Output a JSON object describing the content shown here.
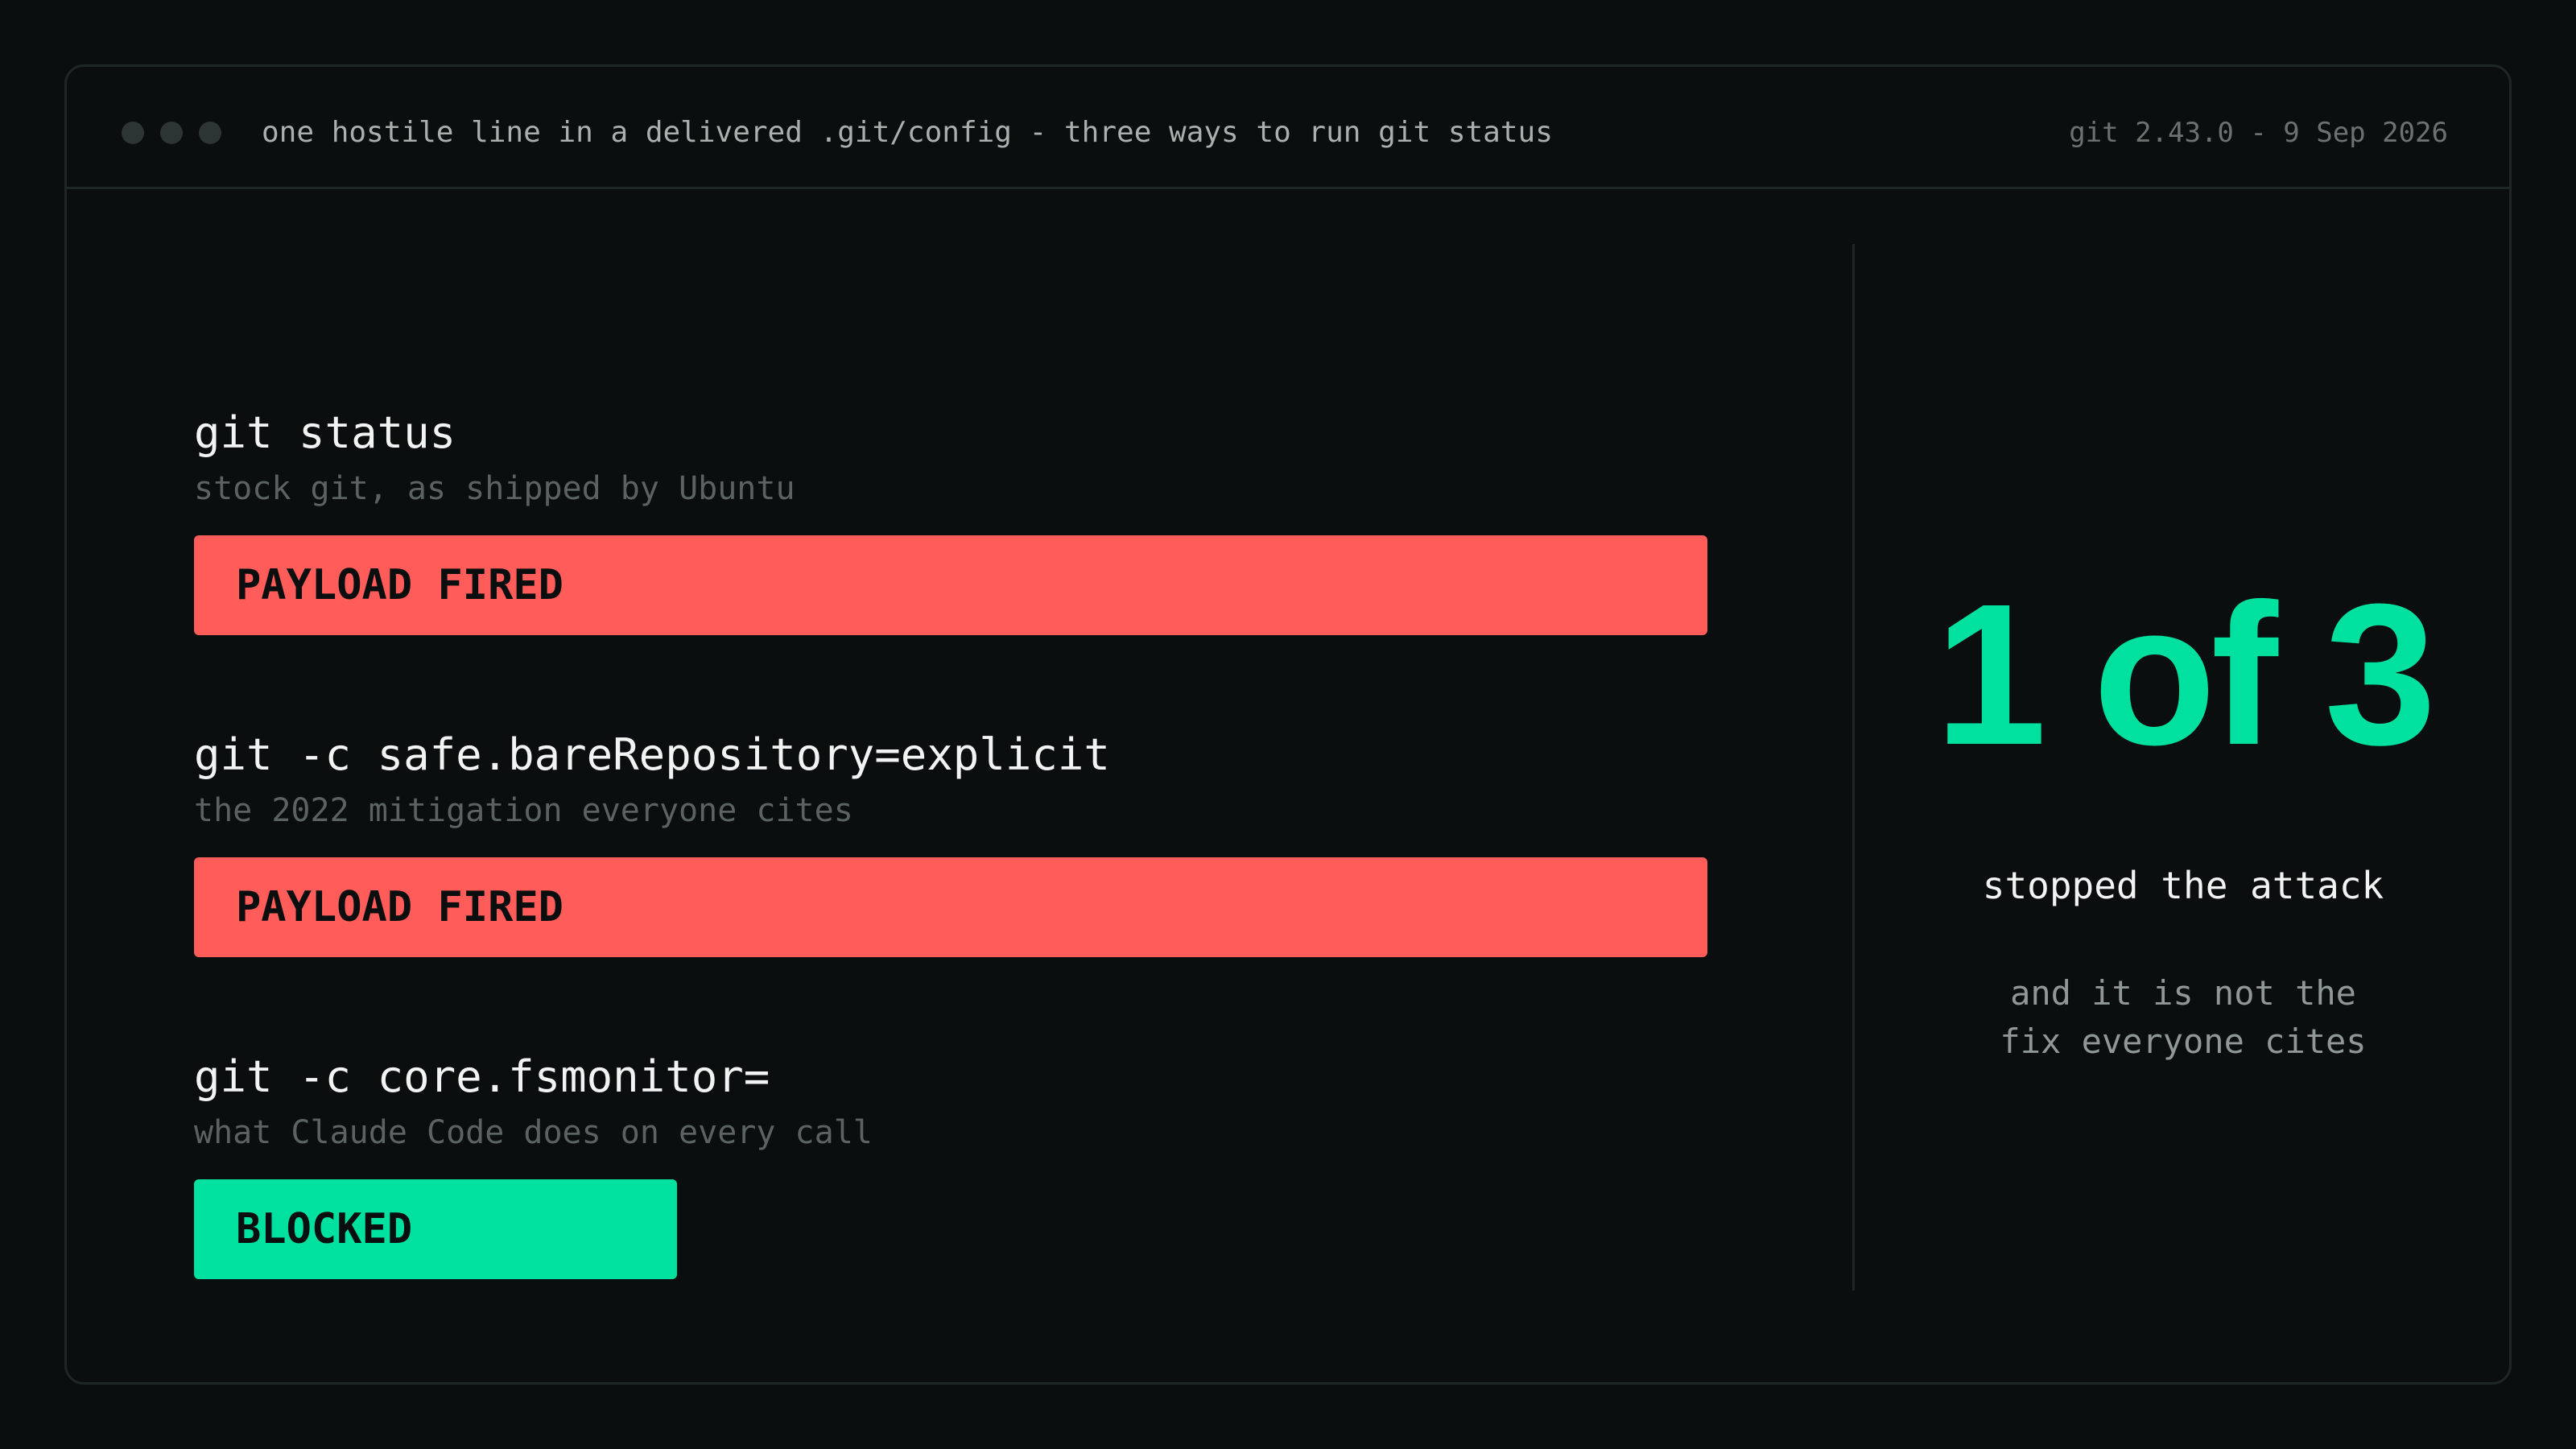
{
  "window": {
    "title": "one hostile line in a delivered .git/config - three ways to run git status",
    "version": "git 2.43.0 - 9 Sep 2026",
    "controls": [
      "window-dot-1",
      "window-dot-2",
      "window-dot-3"
    ]
  },
  "rows": [
    {
      "command": "git status",
      "description": "stock git, as shipped by Ubuntu",
      "result": "PAYLOAD FIRED",
      "status": "fired"
    },
    {
      "command": "git -c safe.bareRepository=explicit",
      "description": "the 2022 mitigation everyone cites",
      "result": "PAYLOAD FIRED",
      "status": "fired"
    },
    {
      "command": "git -c core.fsmonitor=",
      "description": "what Claude Code does on every call",
      "result": "BLOCKED",
      "status": "blocked"
    }
  ],
  "summary": {
    "headline": "1 of 3",
    "subline": "stopped the attack",
    "note_line_1": "and it is not the",
    "note_line_2": "fix everyone cites"
  },
  "colors": {
    "background": "#0a0e0e",
    "fired": "#ff5c5a",
    "blocked": "#00e09e",
    "accent": "#00e09e"
  }
}
